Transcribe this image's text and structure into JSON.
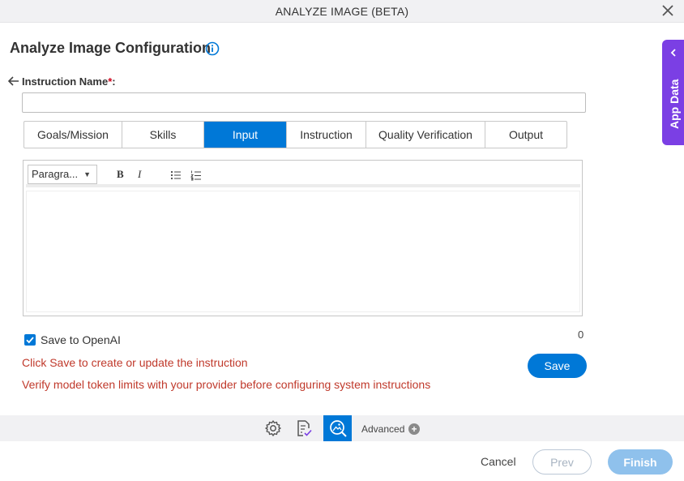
{
  "dialog": {
    "title": "ANALYZE IMAGE (BETA)"
  },
  "page": {
    "heading": "Analyze Image Configuration"
  },
  "instruction": {
    "label": "Instruction Name",
    "required_mark": "*",
    "label_suffix": ":",
    "value": ""
  },
  "tabs": [
    {
      "label": "Goals/Mission",
      "active": false
    },
    {
      "label": "Skills",
      "active": false
    },
    {
      "label": "Input",
      "active": true
    },
    {
      "label": "Instruction",
      "active": false
    },
    {
      "label": "Quality Verification",
      "active": false
    },
    {
      "label": "Output",
      "active": false
    }
  ],
  "editor": {
    "paragraph_select": "Paragra...",
    "bold": "B",
    "italic": "I",
    "content": ""
  },
  "counter": "0",
  "save_to_openai": {
    "label": "Save to OpenAI",
    "checked": true
  },
  "messages": {
    "save_hint": "Click Save to create or update the instruction",
    "token_hint": "Verify model token limits with your provider before configuring system instructions"
  },
  "buttons": {
    "save": "Save",
    "cancel": "Cancel",
    "prev": "Prev",
    "finish": "Finish",
    "advanced": "Advanced"
  },
  "side_panel": {
    "label": "App Data"
  },
  "colors": {
    "primary": "#0078d7",
    "error_text": "#c0392b",
    "side_panel": "#7b3fe4",
    "finish_disabled": "#8fc1ec"
  },
  "icons": {
    "close": "close-icon",
    "info": "info-icon",
    "back": "back-arrow-icon",
    "bullet_list": "bullet-list-icon",
    "numbered_list": "numbered-list-icon",
    "settings": "gear-icon",
    "form": "form-check-icon",
    "analyze": "image-search-icon",
    "plus": "plus-circle-icon",
    "chevron": "chevron-left-icon"
  }
}
